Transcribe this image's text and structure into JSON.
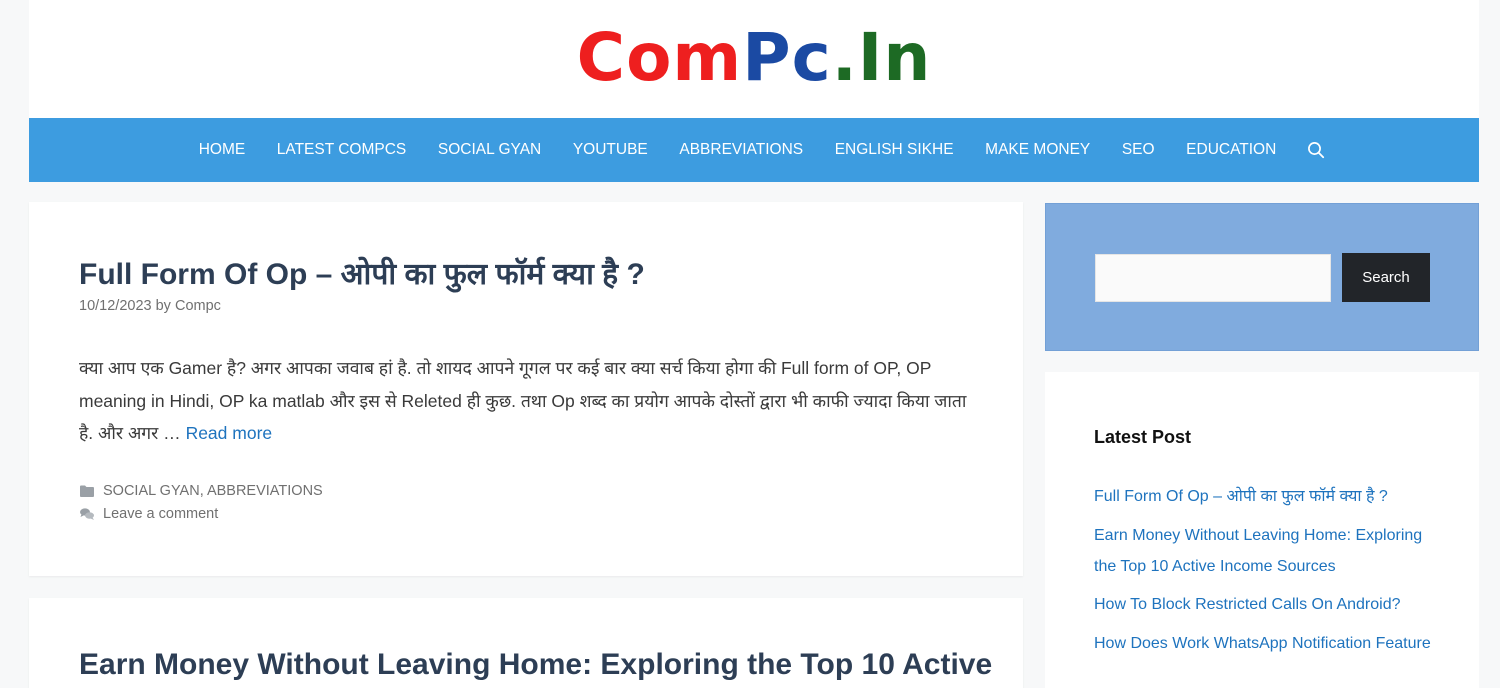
{
  "logo": {
    "parts": [
      {
        "text": "Com",
        "color": "#ee1f1f"
      },
      {
        "text": "Pc",
        "color": "#1b4aa3"
      },
      {
        "text": ".In",
        "color": "#1d6a24"
      }
    ]
  },
  "nav": {
    "items": [
      "HOME",
      "LATEST COMPCS",
      "SOCIAL GYAN",
      "YOUTUBE",
      "ABBREVIATIONS",
      "ENGLISH SIKHE",
      "MAKE MONEY",
      "SEO",
      "EDUCATION"
    ],
    "search_icon": "search-icon",
    "background": "#3d9ce0"
  },
  "articles": [
    {
      "title": "Full Form Of Op – ओपी का फुल फॉर्म क्या है ?",
      "date": "10/12/2023",
      "by": "by",
      "author": "Compc",
      "excerpt": "क्या आप एक Gamer है? अगर आपका जवाब हां है. तो शायद आपने गूगल पर कई बार क्या सर्च किया होगा की Full form of OP, OP meaning in Hindi, OP ka matlab और इस से Releted ही कुछ. तथा Op शब्द का प्रयोग आपके दोस्तों द्वारा भी काफी ज्यादा किया जाता है. और अगर …",
      "read_more": "Read more",
      "categories": "SOCIAL GYAN, ABBREVIATIONS",
      "comment": "Leave a comment"
    },
    {
      "title": "Earn Money Without Leaving Home: Exploring the Top 10 Active"
    }
  ],
  "sidebar": {
    "search_button": "Search",
    "search_placeholder": "",
    "widget_title": "Latest Post",
    "latest_posts": [
      "Full Form Of Op – ओपी का फुल फॉर्म क्या है ?",
      "Earn Money Without Leaving Home: Exploring the Top 10 Active Income Sources",
      "How To Block Restricted Calls On Android?",
      "How Does Work WhatsApp Notification Feature"
    ]
  },
  "colors": {
    "accent": "#1e73be",
    "title": "#2d3e55",
    "search_widget_bg": "#80abde",
    "search_button_bg": "#222529"
  }
}
